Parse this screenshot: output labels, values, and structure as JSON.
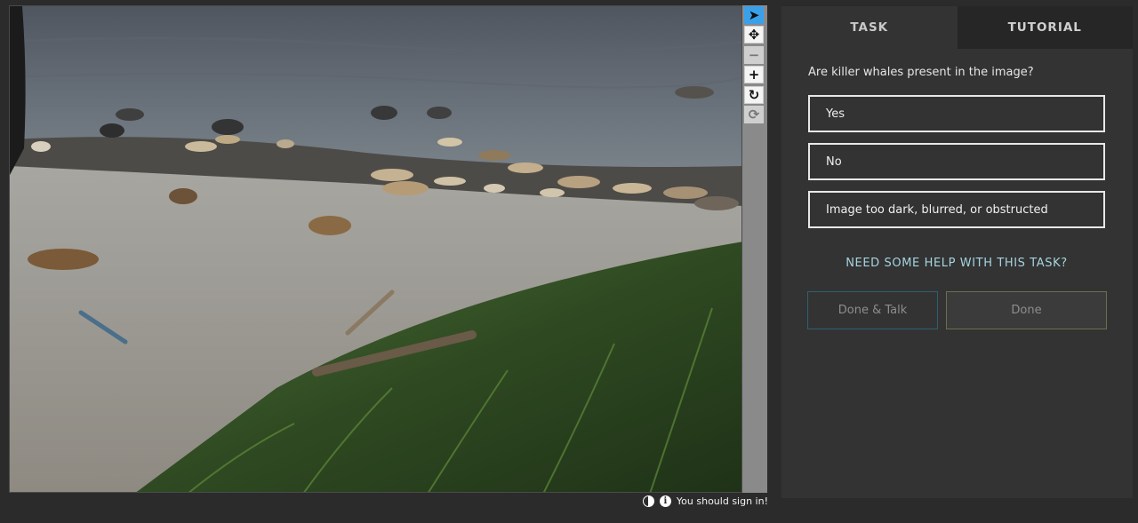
{
  "toolbar": {
    "tools": [
      {
        "name": "pointer",
        "glyph": "➤",
        "active": true
      },
      {
        "name": "pan",
        "glyph": "✥"
      },
      {
        "name": "zoom-out",
        "glyph": "−",
        "disabled": true
      },
      {
        "name": "zoom-in",
        "glyph": "+"
      },
      {
        "name": "rotate",
        "glyph": "↻"
      },
      {
        "name": "reset",
        "glyph": "⟳",
        "disabled": true
      }
    ]
  },
  "footer": {
    "sign_in_text": "You should sign in!",
    "contrast_icon": "contrast-icon",
    "info_icon": "info-icon",
    "info_glyph": "i"
  },
  "panel": {
    "tabs": {
      "task": "TASK",
      "tutorial": "TUTORIAL"
    },
    "question": "Are killer whales present in the image?",
    "answers": [
      "Yes",
      "No",
      "Image too dark, blurred, or obstructed"
    ],
    "help": "NEED SOME HELP WITH THIS TASK?",
    "done_talk": "Done & Talk",
    "done": "Done"
  },
  "colors": {
    "background": "#2b2b2b",
    "panel": "#333333",
    "accent_active_tool": "#3aa0ea",
    "help_link": "#a6d3df"
  }
}
